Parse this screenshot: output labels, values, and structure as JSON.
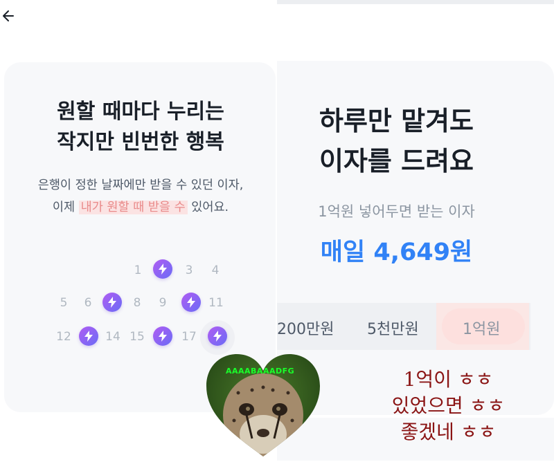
{
  "left_screen": {
    "title_line1": "원할 때마다 누리는",
    "title_line2": "작지만 빈번한 행복",
    "subtitle_line1": "은행이 정한 날짜에만 받을 수 있던 이자,",
    "subtitle_line2_prefix": "이제 ",
    "subtitle_line2_highlight": "내가 원할 때 받을 수",
    "subtitle_line2_suffix": " 있어요.",
    "calendar_numbers": [
      "1",
      "3",
      "4",
      "5",
      "6",
      "8",
      "9",
      "11",
      "12",
      "14",
      "15",
      "17"
    ],
    "bolt_icon": "lightning-icon"
  },
  "right_screen": {
    "title_line1": "하루만 맡겨도",
    "title_line2": "이자를 드려요",
    "subtitle": "1억원 넣어두면 받는 이자",
    "amount": "매일 4,649원",
    "options": [
      "200만원",
      "5천만원",
      "1억원"
    ],
    "selected_option": "1억원"
  },
  "overlay": {
    "caption_line1": "1억이 ㅎㅎ",
    "caption_line2": "있었으면 ㅎㅎ",
    "caption_line3": "좋겠네 ㅎㅎ",
    "watermark": "AAAABAAADFG"
  },
  "colors": {
    "accent_blue": "#3182f6",
    "highlight_pink": "#fbe3e3",
    "bolt_purple": "#8a63f4",
    "caption_red": "#8a1414"
  }
}
